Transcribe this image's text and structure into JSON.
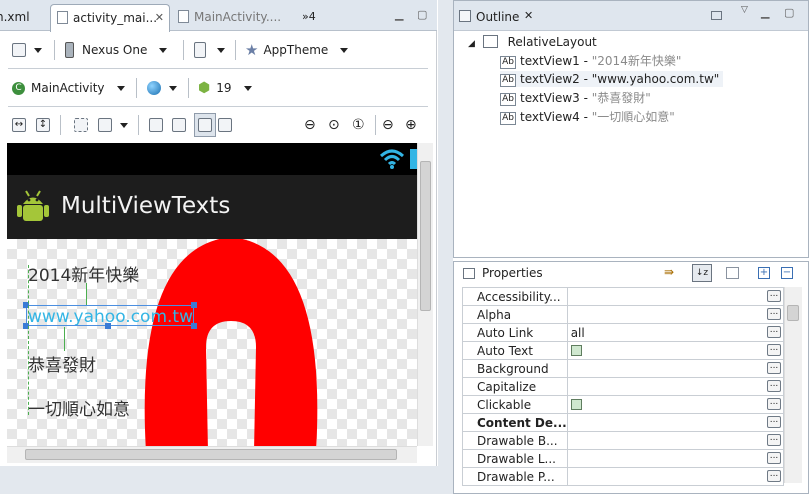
{
  "editor": {
    "tabs": [
      {
        "label": "n.xml",
        "active": false
      },
      {
        "label": "activity_mai...",
        "active": true
      },
      {
        "label": "MainActivity....",
        "active": false
      }
    ],
    "overflow_label": "»4",
    "toolbar1": {
      "device": "Nexus One",
      "theme": "AppTheme"
    },
    "toolbar2": {
      "activity": "MainActivity",
      "api_level": "19"
    }
  },
  "device_preview": {
    "app_title": "MultiViewTexts",
    "text_views": [
      {
        "id": "textView1",
        "text": "2014新年快樂"
      },
      {
        "id": "textView2",
        "text": "www.yahoo.com.tw"
      },
      {
        "id": "textView3",
        "text": "恭喜發財"
      },
      {
        "id": "textView4",
        "text": "一切順心如意"
      }
    ],
    "colors": {
      "statusbar": "#000000",
      "actionbar": "#1d1d1d",
      "link": "#33b5e5",
      "logo": "#ff0000",
      "wifi": "#33b5e5"
    }
  },
  "outline": {
    "title": "Outline",
    "root": "RelativeLayout",
    "children": [
      {
        "name": "textView1",
        "value": "\"2014新年快樂\"",
        "selected": false
      },
      {
        "name": "textView2",
        "value": "\"www.yahoo.com.tw\"",
        "selected": true
      },
      {
        "name": "textView3",
        "value": "\"恭喜發財\"",
        "selected": false
      },
      {
        "name": "textView4",
        "value": "\"一切順心如意\"",
        "selected": false
      }
    ]
  },
  "properties": {
    "title": "Properties",
    "rows": [
      {
        "name": "Accessibility...",
        "value": "",
        "bold": false,
        "checkbox": false
      },
      {
        "name": "Alpha",
        "value": "",
        "bold": false,
        "checkbox": false
      },
      {
        "name": "Auto Link",
        "value": "all",
        "bold": false,
        "checkbox": false
      },
      {
        "name": "Auto Text",
        "value": "",
        "bold": false,
        "checkbox": true
      },
      {
        "name": "Background",
        "value": "",
        "bold": false,
        "checkbox": false
      },
      {
        "name": "Capitalize",
        "value": "",
        "bold": false,
        "checkbox": false
      },
      {
        "name": "Clickable",
        "value": "",
        "bold": false,
        "checkbox": true
      },
      {
        "name": "Content De...",
        "value": "",
        "bold": true,
        "checkbox": false
      },
      {
        "name": "Drawable B...",
        "value": "",
        "bold": false,
        "checkbox": false
      },
      {
        "name": "Drawable L...",
        "value": "",
        "bold": false,
        "checkbox": false
      },
      {
        "name": "Drawable P...",
        "value": "",
        "bold": false,
        "checkbox": false
      }
    ]
  }
}
